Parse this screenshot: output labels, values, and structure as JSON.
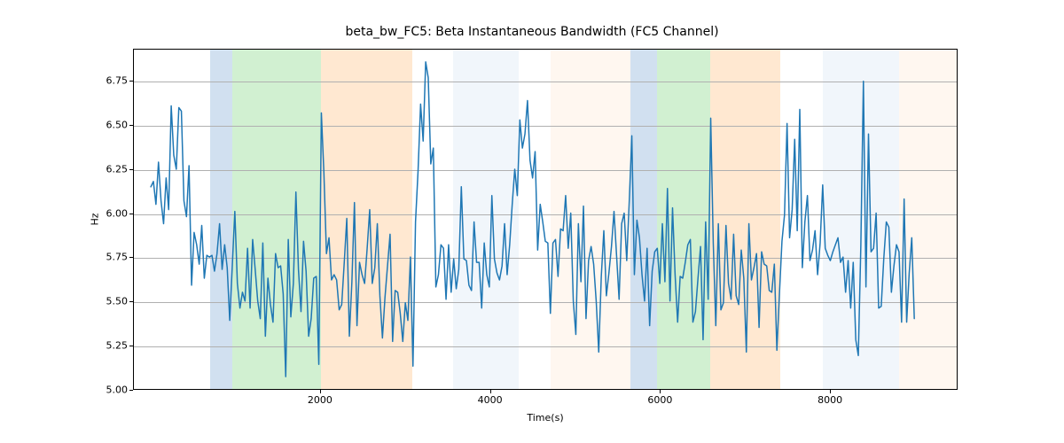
{
  "chart_data": {
    "type": "line",
    "title": "beta_bw_FC5: Beta Instantaneous Bandwidth (FC5 Channel)",
    "xlabel": "Time(s)",
    "ylabel": "Hz",
    "xlim": [
      -200,
      9500
    ],
    "ylim": [
      5.0,
      6.93
    ],
    "xticks": [
      2000,
      4000,
      6000,
      8000
    ],
    "yticks": [
      5.0,
      5.25,
      5.5,
      5.75,
      6.0,
      6.25,
      6.5,
      6.75
    ],
    "xtick_labels": [
      "2000",
      "4000",
      "6000",
      "8000"
    ],
    "ytick_labels": [
      "5.00",
      "5.25",
      "5.50",
      "5.75",
      "6.00",
      "6.25",
      "6.50",
      "6.75"
    ],
    "line_color": "#1f77b4",
    "bands": [
      {
        "x0": 700,
        "x1": 960,
        "color": "#6699cc"
      },
      {
        "x0": 960,
        "x1": 2000,
        "color": "#66cc66"
      },
      {
        "x0": 2000,
        "x1": 3070,
        "color": "#ffb266"
      },
      {
        "x0": 3550,
        "x1": 4020,
        "color": "#cfe0f2"
      },
      {
        "x0": 4020,
        "x1": 4330,
        "color": "#cfe0f2"
      },
      {
        "x0": 4700,
        "x1": 5640,
        "color": "#ffe6cc"
      },
      {
        "x0": 5640,
        "x1": 5950,
        "color": "#6699cc"
      },
      {
        "x0": 5950,
        "x1": 6580,
        "color": "#66cc66"
      },
      {
        "x0": 6580,
        "x1": 7400,
        "color": "#ffb266"
      },
      {
        "x0": 7900,
        "x1": 8800,
        "color": "#cfe0f2"
      },
      {
        "x0": 8800,
        "x1": 9500,
        "color": "#ffe6cc"
      }
    ],
    "x": [
      0,
      30,
      60,
      90,
      120,
      150,
      180,
      210,
      240,
      270,
      300,
      330,
      360,
      390,
      420,
      450,
      480,
      510,
      540,
      570,
      600,
      630,
      660,
      690,
      720,
      750,
      780,
      810,
      840,
      870,
      900,
      930,
      960,
      990,
      1020,
      1050,
      1080,
      1110,
      1140,
      1170,
      1200,
      1230,
      1260,
      1290,
      1320,
      1350,
      1380,
      1410,
      1440,
      1470,
      1500,
      1530,
      1560,
      1590,
      1620,
      1650,
      1680,
      1710,
      1740,
      1770,
      1800,
      1830,
      1860,
      1890,
      1920,
      1950,
      1980,
      2010,
      2040,
      2070,
      2100,
      2130,
      2160,
      2190,
      2220,
      2250,
      2280,
      2310,
      2340,
      2370,
      2400,
      2430,
      2460,
      2490,
      2520,
      2550,
      2580,
      2610,
      2640,
      2670,
      2700,
      2730,
      2760,
      2790,
      2820,
      2850,
      2880,
      2910,
      2940,
      2970,
      3000,
      3030,
      3060,
      3090,
      3120,
      3150,
      3180,
      3210,
      3240,
      3270,
      3300,
      3330,
      3360,
      3390,
      3420,
      3450,
      3480,
      3510,
      3540,
      3570,
      3600,
      3630,
      3660,
      3690,
      3720,
      3750,
      3780,
      3810,
      3840,
      3870,
      3900,
      3930,
      3960,
      3990,
      4020,
      4050,
      4080,
      4110,
      4140,
      4170,
      4200,
      4230,
      4260,
      4290,
      4320,
      4350,
      4380,
      4410,
      4440,
      4470,
      4500,
      4530,
      4560,
      4590,
      4620,
      4650,
      4680,
      4710,
      4740,
      4770,
      4800,
      4830,
      4860,
      4890,
      4920,
      4950,
      4980,
      5010,
      5040,
      5070,
      5100,
      5130,
      5160,
      5190,
      5220,
      5250,
      5280,
      5310,
      5340,
      5370,
      5400,
      5430,
      5460,
      5490,
      5520,
      5550,
      5580,
      5610,
      5640,
      5670,
      5700,
      5730,
      5760,
      5790,
      5820,
      5850,
      5880,
      5910,
      5940,
      5970,
      6000,
      6030,
      6060,
      6090,
      6120,
      6150,
      6180,
      6210,
      6240,
      6270,
      6300,
      6330,
      6360,
      6390,
      6420,
      6450,
      6480,
      6510,
      6540,
      6570,
      6600,
      6630,
      6660,
      6690,
      6720,
      6750,
      6780,
      6810,
      6840,
      6870,
      6900,
      6930,
      6960,
      6990,
      7020,
      7050,
      7080,
      7110,
      7140,
      7170,
      7200,
      7230,
      7260,
      7290,
      7320,
      7350,
      7380,
      7410,
      7440,
      7470,
      7500,
      7530,
      7560,
      7590,
      7620,
      7650,
      7680,
      7710,
      7740,
      7770,
      7800,
      7830,
      7860,
      7890,
      7920,
      7950,
      7980,
      8010,
      8040,
      8070,
      8100,
      8130,
      8160,
      8190,
      8220,
      8250,
      8280,
      8310,
      8340,
      8370,
      8400,
      8430,
      8460,
      8490,
      8520,
      8550,
      8580,
      8610,
      8640,
      8670,
      8700,
      8730,
      8760,
      8790,
      8820,
      8850,
      8880,
      8910,
      8940,
      8970,
      9000,
      9030,
      9060,
      9090,
      9120,
      9150,
      9180,
      9210,
      9240,
      9270,
      9300
    ],
    "values": [
      6.15,
      6.18,
      6.05,
      6.29,
      6.07,
      5.94,
      6.2,
      6.02,
      6.61,
      6.33,
      6.25,
      6.6,
      6.58,
      6.07,
      5.98,
      6.27,
      5.59,
      5.89,
      5.82,
      5.71,
      5.93,
      5.63,
      5.76,
      5.75,
      5.76,
      5.67,
      5.77,
      5.94,
      5.68,
      5.82,
      5.69,
      5.39,
      5.7,
      6.01,
      5.6,
      5.46,
      5.55,
      5.5,
      5.8,
      5.46,
      5.85,
      5.68,
      5.5,
      5.4,
      5.83,
      5.3,
      5.63,
      5.48,
      5.38,
      5.77,
      5.69,
      5.7,
      5.54,
      5.07,
      5.85,
      5.41,
      5.6,
      6.12,
      5.68,
      5.44,
      5.84,
      5.67,
      5.3,
      5.4,
      5.63,
      5.64,
      5.14,
      6.57,
      6.23,
      5.77,
      5.86,
      5.62,
      5.65,
      5.62,
      5.45,
      5.48,
      5.72,
      5.97,
      5.3,
      5.61,
      6.06,
      5.36,
      5.72,
      5.65,
      5.6,
      5.8,
      6.02,
      5.6,
      5.69,
      5.94,
      5.53,
      5.29,
      5.52,
      5.7,
      5.88,
      5.27,
      5.56,
      5.55,
      5.43,
      5.27,
      5.49,
      5.39,
      5.75,
      5.13,
      5.95,
      6.24,
      6.62,
      6.41,
      6.86,
      6.77,
      6.28,
      6.37,
      5.58,
      5.65,
      5.82,
      5.8,
      5.51,
      5.82,
      5.55,
      5.74,
      5.57,
      5.68,
      6.15,
      5.74,
      5.73,
      5.59,
      5.56,
      5.95,
      5.72,
      5.72,
      5.46,
      5.83,
      5.65,
      5.58,
      6.1,
      5.74,
      5.66,
      5.62,
      5.7,
      5.94,
      5.65,
      5.82,
      6.05,
      6.25,
      6.1,
      6.53,
      6.37,
      6.45,
      6.64,
      6.3,
      6.2,
      6.35,
      5.79,
      6.05,
      5.95,
      5.84,
      5.83,
      5.43,
      5.83,
      5.85,
      5.64,
      5.91,
      5.9,
      6.1,
      5.8,
      6.0,
      5.5,
      5.31,
      5.94,
      5.61,
      6.04,
      5.4,
      5.73,
      5.81,
      5.71,
      5.5,
      5.21,
      5.64,
      5.9,
      5.53,
      5.66,
      5.81,
      6.01,
      5.76,
      5.51,
      5.94,
      6.0,
      5.73,
      6.07,
      6.44,
      5.65,
      5.96,
      5.86,
      5.65,
      5.5,
      5.8,
      5.36,
      5.67,
      5.78,
      5.8,
      5.6,
      5.94,
      5.61,
      6.14,
      5.5,
      6.03,
      5.65,
      5.38,
      5.64,
      5.63,
      5.72,
      5.82,
      5.85,
      5.38,
      5.44,
      5.63,
      5.81,
      5.28,
      5.95,
      5.51,
      6.54,
      5.83,
      5.36,
      5.94,
      5.45,
      5.49,
      5.93,
      5.6,
      5.51,
      5.88,
      5.53,
      5.48,
      5.79,
      5.63,
      5.21,
      5.94,
      5.62,
      5.69,
      5.77,
      5.35,
      5.78,
      5.71,
      5.7,
      5.56,
      5.55,
      5.71,
      5.22,
      5.54,
      5.84,
      5.99,
      6.51,
      5.86,
      6.02,
      6.42,
      5.9,
      6.59,
      5.69,
      5.95,
      6.1,
      5.73,
      5.79,
      5.9,
      5.65,
      5.83,
      6.16,
      5.8,
      5.76,
      5.73,
      5.78,
      5.82,
      5.86,
      5.72,
      5.75,
      5.55,
      5.73,
      5.46,
      5.72,
      5.28,
      5.19,
      5.82,
      6.75,
      5.58,
      6.45,
      5.78,
      5.8,
      6.0,
      5.46,
      5.47,
      5.74,
      5.95,
      5.92,
      5.55,
      5.7,
      5.82,
      5.78,
      5.38,
      6.08,
      5.38,
      5.66,
      5.86,
      5.4
    ]
  }
}
